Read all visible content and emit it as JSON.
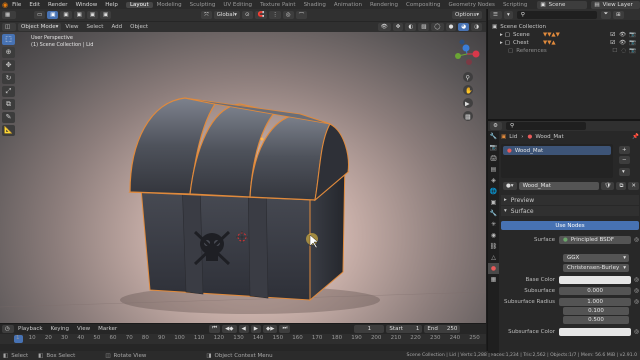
{
  "topbar": {
    "menus": [
      "File",
      "Edit",
      "Render",
      "Window",
      "Help"
    ],
    "workspaces": [
      "Layout",
      "Modeling",
      "Sculpting",
      "UV Editing",
      "Texture Paint",
      "Shading",
      "Animation",
      "Rendering",
      "Compositing",
      "Geometry Nodes",
      "Scripting"
    ],
    "scene": "Scene",
    "view_layer": "View Layer"
  },
  "viewport_header": {
    "mode": "Object Mode",
    "menus": [
      "View",
      "Select",
      "Add",
      "Object"
    ],
    "orientation": "Global",
    "options": "Options"
  },
  "viewport": {
    "overlay_line1": "User Perspective",
    "overlay_line2": "(1) Scene Collection | Lid"
  },
  "outliner": {
    "root": "Scene Collection",
    "items": [
      "Scene",
      "Chest",
      "References"
    ]
  },
  "properties": {
    "object_name": "Lid",
    "material_name": "Wood_Mat",
    "slot_name": "Wood_Mat",
    "datablock": "Wood_Mat",
    "preview": "Preview",
    "surface": "Surface",
    "use_nodes": "Use Nodes",
    "surface_label": "Surface",
    "surface_value": "Principled BSDF",
    "distribution": "GGX",
    "subsurface_method": "Christensen-Burley",
    "base_color_label": "Base Color",
    "subsurface_label": "Subsurface",
    "subsurface_value": "0.000",
    "subsurface_radius_label": "Subsurface Radius",
    "radius": [
      "1.000",
      "0.100",
      "0.500"
    ],
    "subsurface_color_label": "Subsurface Color"
  },
  "timeline": {
    "menus": [
      "Playback",
      "Keying",
      "View",
      "Marker"
    ],
    "current_frame": "1",
    "start_label": "Start",
    "start": "1",
    "end_label": "End",
    "end": "250",
    "ticks": [
      "1",
      "10",
      "20",
      "30",
      "40",
      "50",
      "60",
      "70",
      "80",
      "90",
      "100",
      "110",
      "120",
      "130",
      "140",
      "150",
      "160",
      "170",
      "180",
      "190",
      "200",
      "210",
      "220",
      "230",
      "240",
      "250"
    ]
  },
  "statusbar": {
    "left": [
      "Select",
      "Box Select",
      "Rotate View",
      "Object Context Menu"
    ],
    "right": "Scene Collection | Lid | Verts:1,288 | Faces:1,234 | Tris:2,562 | Objects:1/7 | Mem: 56.6 MiB | v2.91.0"
  },
  "colors": {
    "accent": "#4772b3",
    "selection_outline": "#e08a3c",
    "base_color": "#e6e6e6"
  }
}
